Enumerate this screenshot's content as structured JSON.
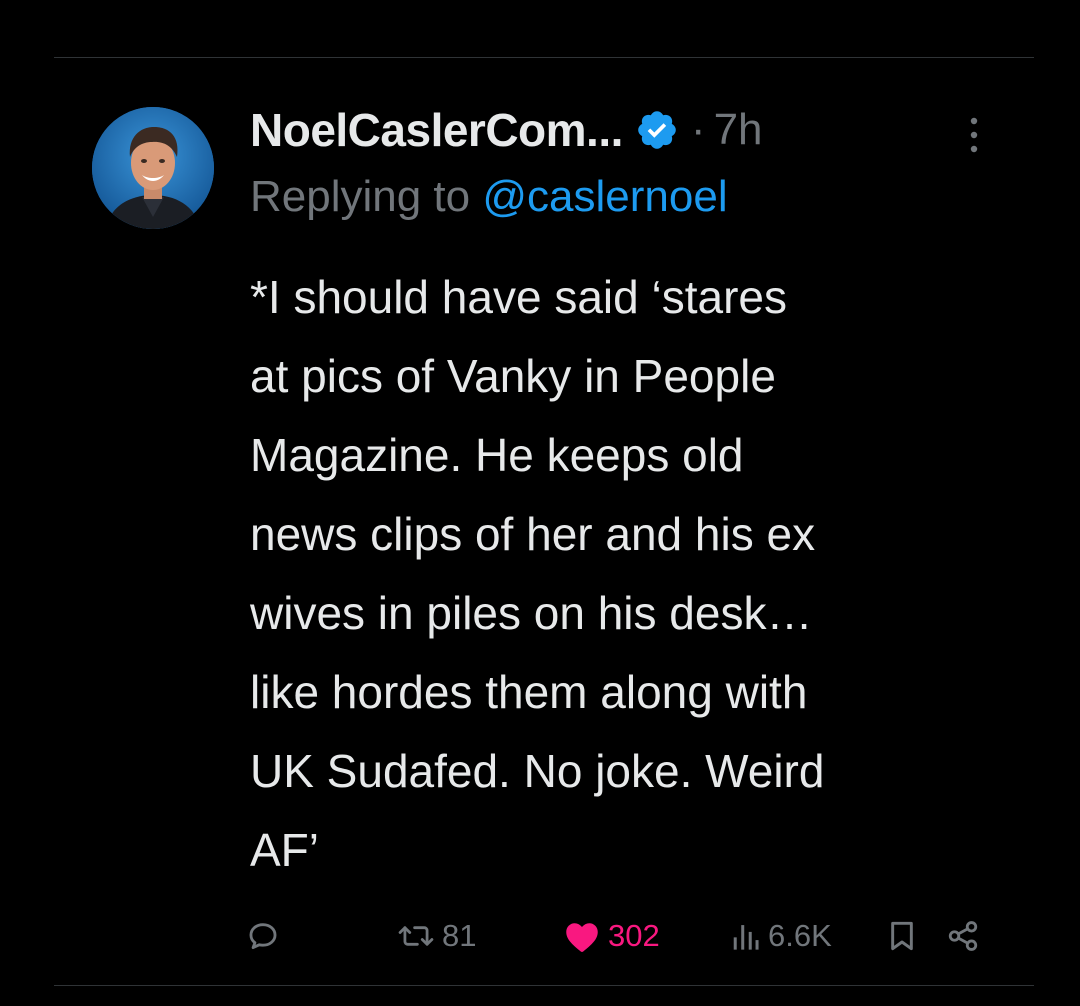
{
  "tweet": {
    "display_name": "NoelCaslerCom...",
    "separator": "·",
    "time": "7h",
    "reply_prefix": "Replying to",
    "reply_handle": "@caslernoel",
    "body_lines": [
      "*I should have said ‘stares",
      "at pics of Vanky in People",
      "Magazine. He keeps old",
      "news clips of her and his ex",
      "wives in piles on his desk…",
      "like hordes them along with",
      "UK Sudafed. No joke. Weird",
      "AF’"
    ]
  },
  "actions": {
    "retweets": "81",
    "likes": "302",
    "views": "6.6K"
  },
  "icons": {
    "reply": "reply-icon",
    "retweet": "retweet-icon",
    "like": "heart-icon",
    "views": "views-icon",
    "bookmark": "bookmark-icon",
    "share": "share-icon",
    "verified": "verified-badge-icon",
    "more": "more-icon"
  },
  "colors": {
    "background": "#000000",
    "text": "#e7e9ea",
    "secondary": "#71767b",
    "link": "#1d9bf0",
    "like": "#f91880",
    "verified": "#1d9bf0"
  }
}
